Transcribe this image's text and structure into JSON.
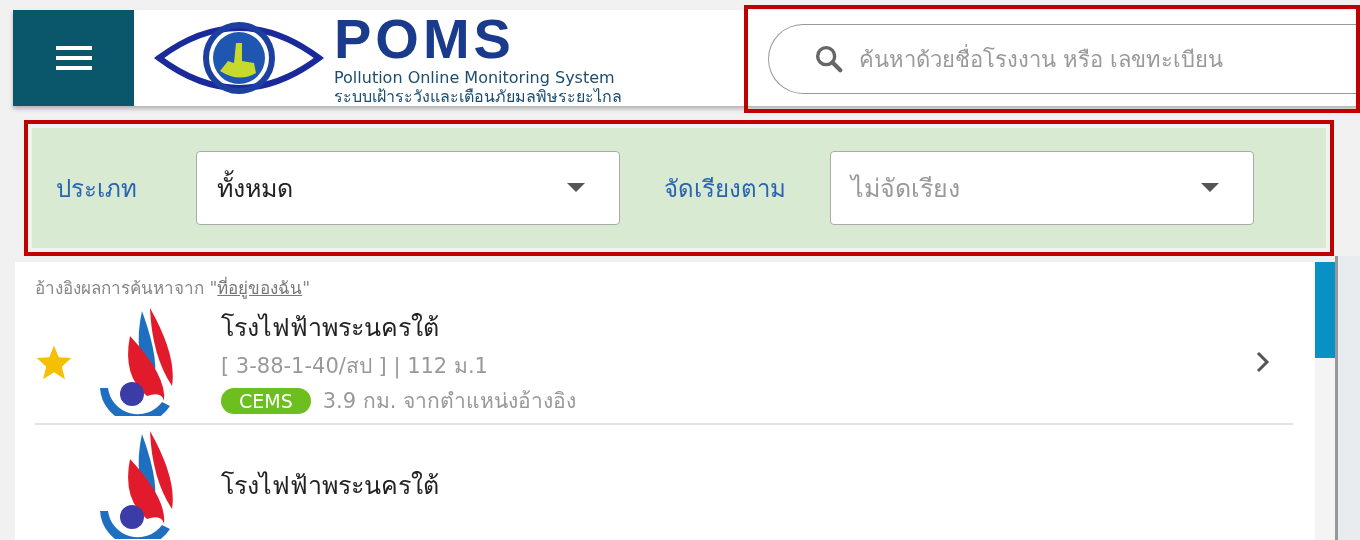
{
  "header": {
    "title": "POMS",
    "subtitle": "Pollution Online Monitoring System",
    "subtitle_thai": "ระบบเฝ้าระวังและเตือนภัยมลพิษระยะไกล"
  },
  "search": {
    "placeholder": "ค้นหาด้วยชื่อโรงงาน หรือ เลขทะเบียน",
    "highlighted": true
  },
  "filters": {
    "highlighted": true,
    "items": [
      {
        "label": "ประเภท",
        "value": "ทั้งหมด",
        "is_placeholder": false
      },
      {
        "label": "จัดเรียงตาม",
        "value": "ไม่จัดเรียง",
        "is_placeholder": true
      }
    ]
  },
  "reference": {
    "text": "อ้างอิงผลการค้นหาจาก \"",
    "link": "ที่อยู่ของฉัน",
    "end": "\""
  },
  "results": [
    {
      "name": "โรงไฟฟ้าพระนครใต้",
      "starred": true,
      "code": "[ 3-88-1-40/สป ] | 112 ม.1",
      "tag": "CEMS",
      "distance": "3.9 กม. จากตำแหน่งอ้างอิง"
    },
    {
      "name": "โรงไฟฟ้าพระนครใต้"
    }
  ]
}
